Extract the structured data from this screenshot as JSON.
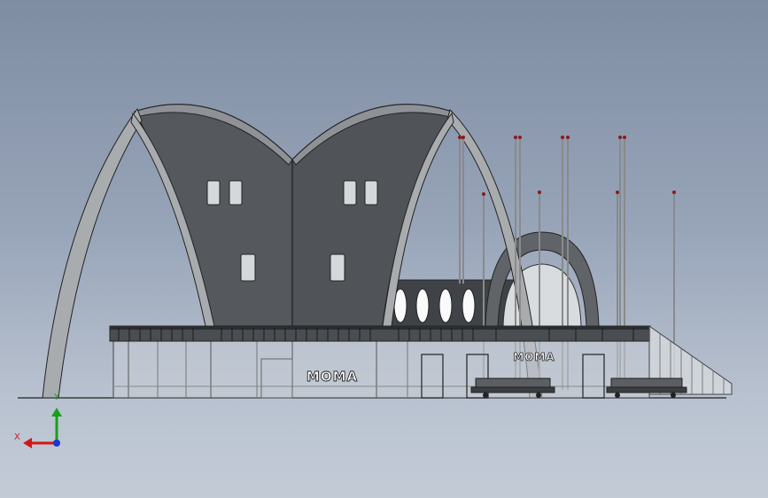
{
  "model": {
    "sign_main": "MOMA",
    "sign_secondary": "MOMA"
  },
  "triad": {
    "x_label": "X",
    "y_label": "Y",
    "x_color": "#d01818",
    "y_color": "#18a018",
    "z_color": "#1838d0"
  },
  "colors": {
    "roof_shell": "#55585d",
    "roof_rim": "#8e9296",
    "arch": "#a9acaf",
    "pole": "#9a9a9a",
    "pole_cap": "#8a1a1a"
  }
}
